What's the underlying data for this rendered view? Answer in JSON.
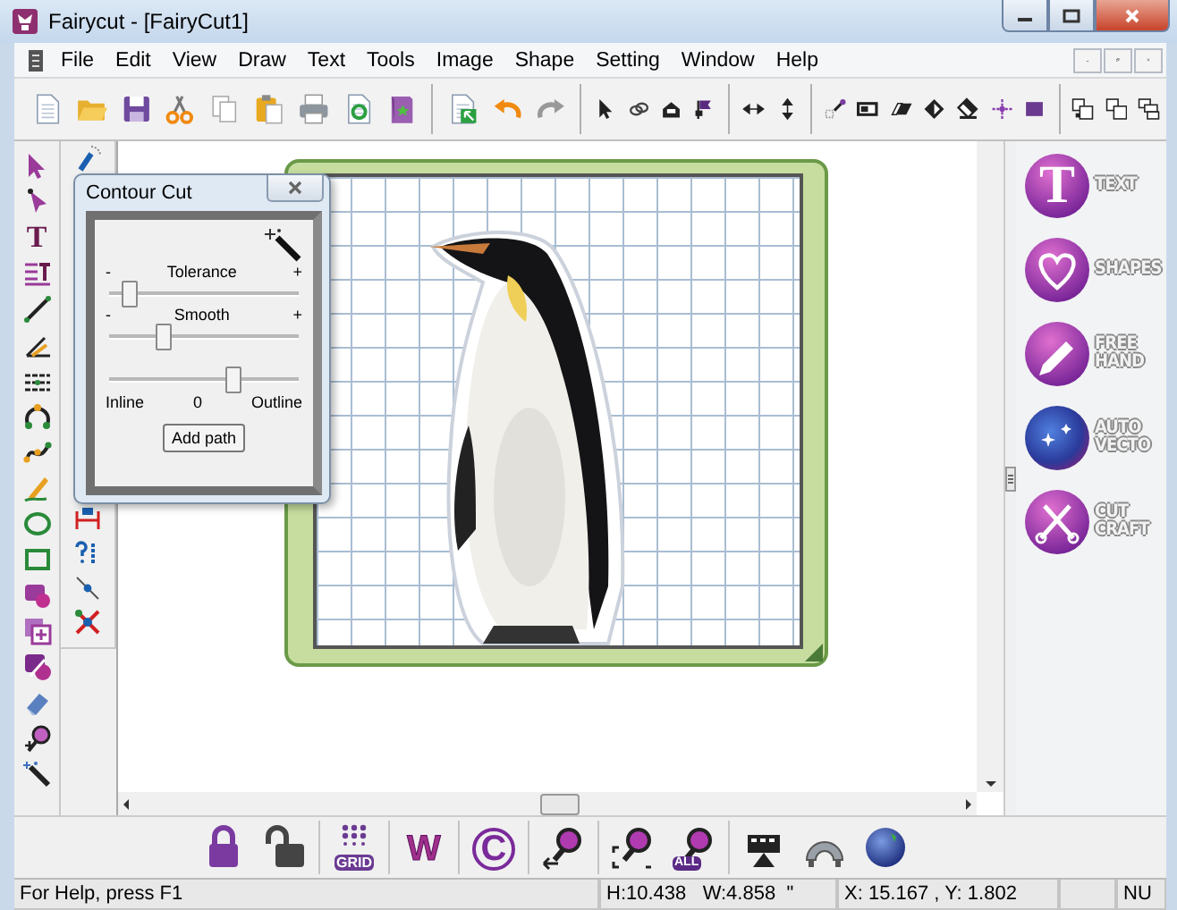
{
  "window": {
    "title": "Fairycut - [FairyCut1]"
  },
  "menu": [
    {
      "label": "File"
    },
    {
      "label": "Edit"
    },
    {
      "label": "View"
    },
    {
      "label": "Draw"
    },
    {
      "label": "Text"
    },
    {
      "label": "Tools"
    },
    {
      "label": "Image"
    },
    {
      "label": "Shape"
    },
    {
      "label": "Setting"
    },
    {
      "label": "Window"
    },
    {
      "label": "Help"
    }
  ],
  "left_toolbar": {
    "text_tool_glyph": "T"
  },
  "dialog": {
    "title": "Contour Cut",
    "sliders": [
      {
        "label": "Tolerance",
        "min_mark": "-",
        "max_mark": "+",
        "level": 0.1
      },
      {
        "label": "Smooth",
        "min_mark": "-",
        "max_mark": "+",
        "level": 0.28
      },
      {
        "level": 0.65,
        "left_label": "Inline",
        "center_label": "0",
        "right_label": "Outline"
      }
    ],
    "button": "Add path"
  },
  "right_panel": [
    {
      "kind": "text",
      "label": "TEXT",
      "glyph": "T"
    },
    {
      "kind": "shapes",
      "label": "SHAPES"
    },
    {
      "kind": "freehand",
      "label": "FREE\nHAND"
    },
    {
      "kind": "autovecto",
      "label": "AUTO\nVECTO"
    },
    {
      "kind": "cutcraft",
      "label": "CUT\nCRAFT"
    }
  ],
  "bottom_toolbar": {
    "grid_label": "GRID",
    "w_glyph": "W",
    "c_glyph": "C",
    "all_label": "ALL"
  },
  "status_bar": {
    "help": "For Help, press F1",
    "size": "H:10.438   W:4.858  \"",
    "position": "X: 15.167 , Y: 1.802",
    "num_lock": "NU"
  }
}
